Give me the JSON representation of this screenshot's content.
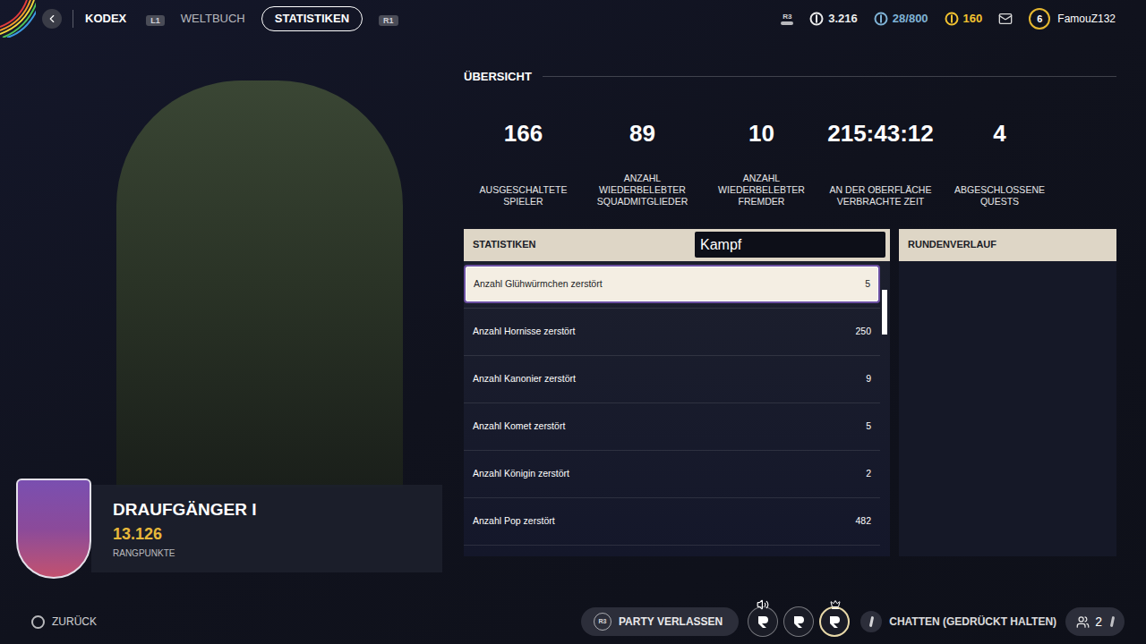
{
  "topbar": {
    "section": "KODEX",
    "prev_key": "L1",
    "next_key": "R1",
    "tabs": [
      {
        "label": "WELTBUCH",
        "selected": false
      },
      {
        "label": "STATISTIKEN",
        "selected": true
      }
    ],
    "stick_key": "R3",
    "currencies": [
      {
        "value": "3.216",
        "color": "#ececec"
      },
      {
        "value": "28/800",
        "color": "#7fb3d6"
      },
      {
        "value": "160",
        "color": "#f2c230"
      }
    ],
    "level": "6",
    "username": "FamouZ132"
  },
  "rank": {
    "title": "DRAUFGÄNGER I",
    "points": "13.126",
    "points_label": "RANGPUNKTE"
  },
  "overview": {
    "title": "ÜBERSICHT",
    "stats": [
      {
        "value": "166",
        "label": "AUSGESCHALTETE SPIELER"
      },
      {
        "value": "89",
        "label": "ANZAHL WIEDERBELEBTER SQUADMITGLIEDER"
      },
      {
        "value": "10",
        "label": "ANZAHL WIEDERBELEBTER FREMDER"
      },
      {
        "value": "215:43:12",
        "label": "AN DER OBERFLÄCHE VERBRACHTE ZEIT"
      },
      {
        "value": "4",
        "label": "ABGESCHLOSSENE QUESTS"
      }
    ]
  },
  "stats_panel": {
    "title": "STATISTIKEN",
    "filter": "Kampf",
    "rows": [
      {
        "label": "Anzahl Glühwürmchen zerstört",
        "value": "5",
        "selected": true
      },
      {
        "label": "Anzahl Hornisse zerstört",
        "value": "250",
        "selected": false
      },
      {
        "label": "Anzahl Kanonier zerstört",
        "value": "9",
        "selected": false
      },
      {
        "label": "Anzahl Komet zerstört",
        "value": "5",
        "selected": false
      },
      {
        "label": "Anzahl Königin zerstört",
        "value": "2",
        "selected": false
      },
      {
        "label": "Anzahl Pop zerstört",
        "value": "482",
        "selected": false
      }
    ]
  },
  "history_panel": {
    "title": "RUNDENVERLAUF"
  },
  "bottom": {
    "back": "ZURÜCK",
    "party_key": "R3",
    "party_action": "PARTY VERLASSEN",
    "members": [
      {
        "speaking": true,
        "leader": false,
        "selected": false
      },
      {
        "speaking": false,
        "leader": false,
        "selected": false
      },
      {
        "speaking": false,
        "leader": true,
        "selected": true
      }
    ],
    "chat": "CHATTEN (GEDRÜCKT HALTEN)",
    "party_size": "2"
  }
}
